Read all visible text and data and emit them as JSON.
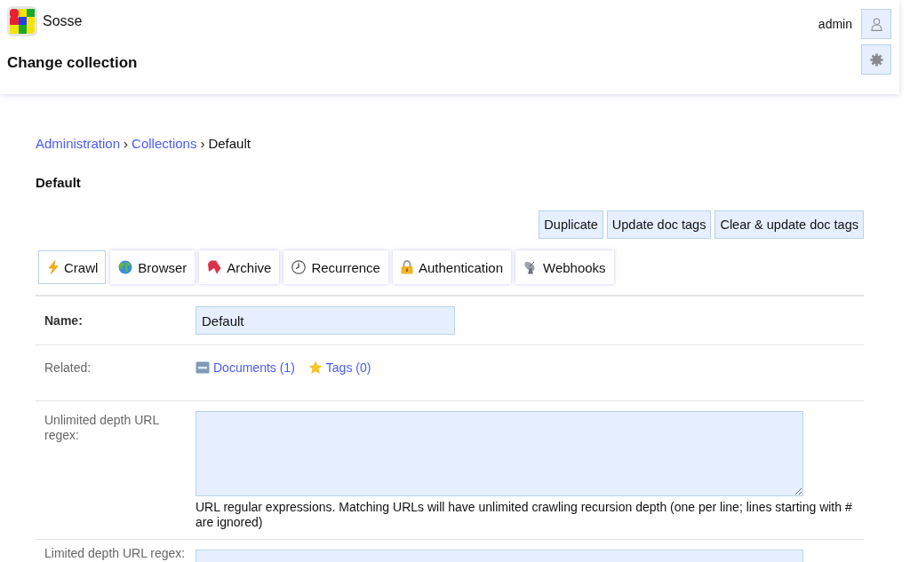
{
  "header": {
    "app_name": "Sosse",
    "page_title": "Change collection",
    "username": "admin"
  },
  "breadcrumb": [
    {
      "kind": "link",
      "label": "Administration"
    },
    {
      "kind": "separator",
      "label": "›"
    },
    {
      "kind": "link",
      "label": "Collections"
    },
    {
      "kind": "separator",
      "label": "›"
    },
    {
      "kind": "current",
      "label": "Default"
    }
  ],
  "heading": "Default",
  "actions": [
    {
      "label": "Duplicate"
    },
    {
      "label": "Update doc tags"
    },
    {
      "label": "Clear & update doc tags"
    }
  ],
  "tabs": [
    {
      "label": "Crawl",
      "selected": true
    },
    {
      "label": "Browser",
      "selected": false
    },
    {
      "label": "Archive",
      "selected": false
    },
    {
      "label": "Recurrence",
      "selected": false
    },
    {
      "label": "Authentication",
      "selected": false
    },
    {
      "label": "Webhooks",
      "selected": false
    }
  ],
  "form": {
    "rows": [
      {
        "kind": "text",
        "label": "Name:",
        "required": true,
        "value": "Default"
      },
      {
        "kind": "links",
        "label": "Related:",
        "required": false,
        "links": [
          {
            "label": "Documents (1)"
          },
          {
            "label": "Tags (0)"
          }
        ]
      },
      {
        "kind": "textarea",
        "label": "Unlimited depth URL regex:",
        "required": false,
        "help": "URL regular expressions. Matching URLs will have unlimited crawling recursion depth (one per line; lines starting with # are ignored)"
      },
      {
        "kind": "textarea",
        "label": "Limited depth URL regex:",
        "required": false
      }
    ]
  }
}
